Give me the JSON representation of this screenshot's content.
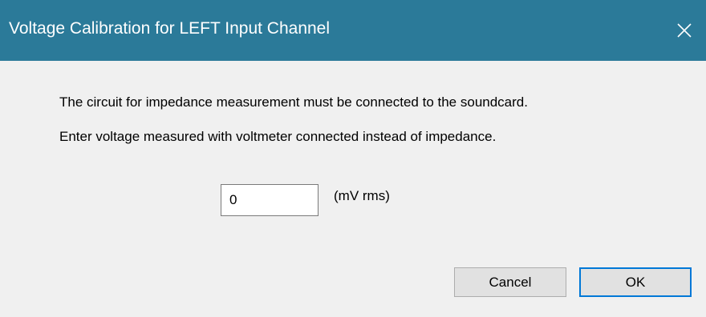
{
  "window": {
    "title": "Voltage Calibration for LEFT Input Channel",
    "close_icon": "close-icon"
  },
  "dialog": {
    "message_line1": "The circuit for impedance measurement must be connected to the soundcard.",
    "message_line2": "Enter voltage measured with voltmeter connected instead of impedance.",
    "voltage_value": "0",
    "unit_label": "(mV rms)"
  },
  "buttons": {
    "cancel_label": "Cancel",
    "ok_label": "OK"
  },
  "colors": {
    "titlebar": "#2b7a99",
    "focus_border": "#0078d7"
  }
}
